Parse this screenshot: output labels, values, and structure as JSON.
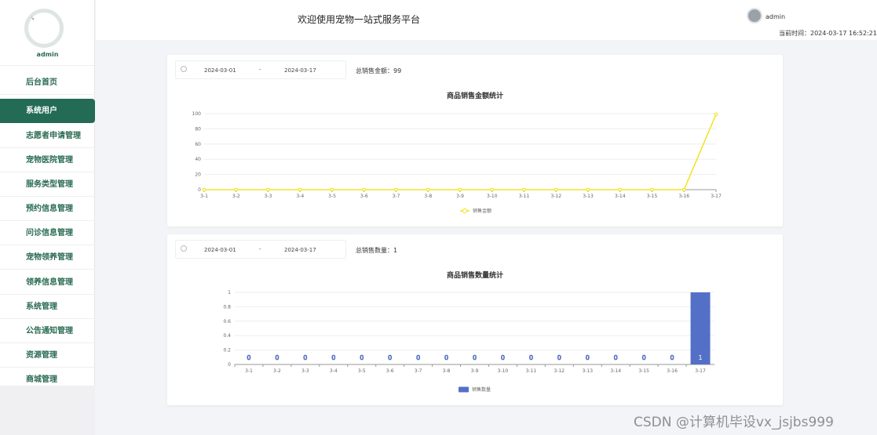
{
  "sidebar": {
    "username": "admin",
    "avatar_text": "↘",
    "items": [
      {
        "label": "后台首页"
      },
      {
        "label": "系统用户"
      },
      {
        "label": "志愿者申请管理"
      },
      {
        "label": "宠物医院管理"
      },
      {
        "label": "服务类型管理"
      },
      {
        "label": "预约信息管理"
      },
      {
        "label": "问诊信息管理"
      },
      {
        "label": "宠物领养管理"
      },
      {
        "label": "领养信息管理"
      },
      {
        "label": "系统管理"
      },
      {
        "label": "公告通知管理"
      },
      {
        "label": "资源管理"
      },
      {
        "label": "商城管理"
      }
    ],
    "active_index": 1
  },
  "header": {
    "title": "欢迎使用宠物一站式服务平台",
    "user": "admin",
    "time_label": "当前时间：",
    "time_value": "2024-03-17 16:52:21"
  },
  "card1": {
    "start_date": "2024-03-01",
    "separator": "-",
    "end_date": "2024-03-17",
    "summary_label": "总销售金额：",
    "summary_value": "99"
  },
  "card2": {
    "start_date": "2024-03-01",
    "separator": "-",
    "end_date": "2024-03-17",
    "summary_label": "总销售数量：",
    "summary_value": "1"
  },
  "chart_data": [
    {
      "type": "line",
      "title": "商品销售金额统计",
      "categories": [
        "3-1",
        "3-2",
        "3-3",
        "3-4",
        "3-5",
        "3-6",
        "3-7",
        "3-8",
        "3-9",
        "3-10",
        "3-11",
        "3-12",
        "3-13",
        "3-14",
        "3-15",
        "3-16",
        "3-17"
      ],
      "series": [
        {
          "name": "销售金额",
          "values": [
            0,
            0,
            0,
            0,
            0,
            0,
            0,
            0,
            0,
            0,
            0,
            0,
            0,
            0,
            0,
            0,
            99
          ],
          "color": "#f2e000"
        }
      ],
      "ylim": [
        0,
        100
      ],
      "yticks": [
        0,
        20,
        40,
        60,
        80,
        100
      ],
      "grid": true,
      "legend": "bottom"
    },
    {
      "type": "bar",
      "title": "商品销售数量统计",
      "categories": [
        "3-1",
        "3-2",
        "3-3",
        "3-4",
        "3-5",
        "3-6",
        "3-7",
        "3-8",
        "3-9",
        "3-10",
        "3-11",
        "3-12",
        "3-13",
        "3-14",
        "3-15",
        "3-16",
        "3-17"
      ],
      "series": [
        {
          "name": "销售数量",
          "values": [
            0,
            0,
            0,
            0,
            0,
            0,
            0,
            0,
            0,
            0,
            0,
            0,
            0,
            0,
            0,
            0,
            1
          ],
          "color": "#5470c6"
        }
      ],
      "ylim": [
        0,
        1
      ],
      "yticks": [
        "0",
        "0.2",
        "0.4",
        "0.6",
        "0.8",
        "1"
      ],
      "data_labels": true,
      "grid": true,
      "legend": "bottom"
    }
  ],
  "watermark": "CSDN @计算机毕设vx_jsjbs999"
}
